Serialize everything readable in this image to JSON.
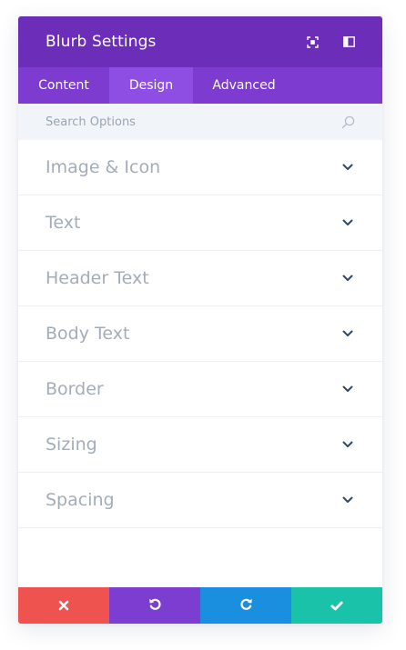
{
  "header": {
    "title": "Blurb Settings",
    "icons": [
      "expand-icon",
      "sidebar-icon"
    ]
  },
  "tabs": [
    {
      "label": "Content",
      "active": false
    },
    {
      "label": "Design",
      "active": true
    },
    {
      "label": "Advanced",
      "active": false
    }
  ],
  "search": {
    "placeholder": "Search Options",
    "value": ""
  },
  "sections": [
    {
      "label": "Image & Icon"
    },
    {
      "label": "Text"
    },
    {
      "label": "Header Text"
    },
    {
      "label": "Body Text"
    },
    {
      "label": "Border"
    },
    {
      "label": "Sizing"
    },
    {
      "label": "Spacing"
    }
  ],
  "footer": {
    "buttons": [
      {
        "name": "cancel",
        "icon": "close-icon",
        "color": "#ef5350"
      },
      {
        "name": "undo",
        "icon": "undo-icon",
        "color": "#7b3ed1"
      },
      {
        "name": "redo",
        "icon": "redo-icon",
        "color": "#1a8fe0"
      },
      {
        "name": "save",
        "icon": "check-icon",
        "color": "#19c2a8"
      }
    ]
  },
  "colors": {
    "header_bg": "#6c2eb9",
    "tabs_bg": "#7d3bcf",
    "active_tab_bg": "#8f4ee3",
    "search_bg": "#f1f5f9",
    "section_text": "#a3acb9",
    "chevron": "#2f4a66"
  }
}
